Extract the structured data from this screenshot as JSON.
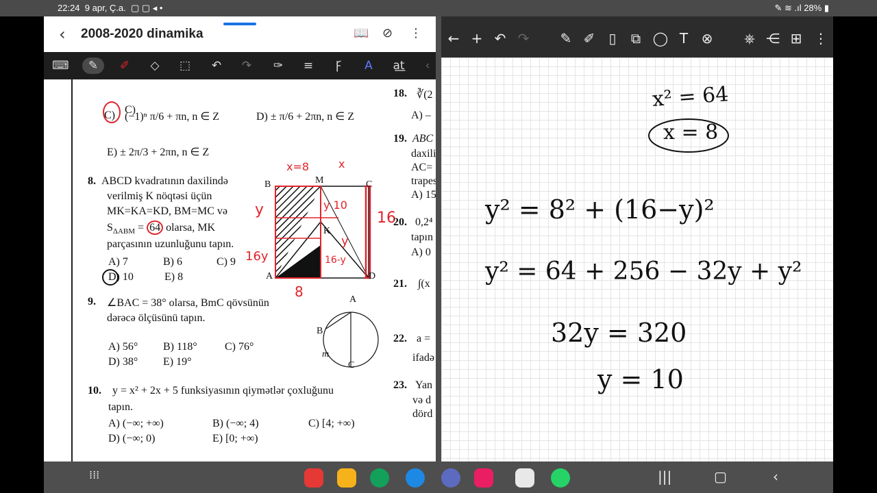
{
  "status": {
    "time": "22:24",
    "date": "9 apr, Ç.a.",
    "battery": "28%"
  },
  "doc": {
    "title": "2008-2020 dinamika",
    "q8": {
      "num": "8.",
      "l1": "ABCD kvadratının daxilində",
      "l2": "verilmiş K nöqtəsi üçün",
      "l3": "MK=KA=KD, BM=MC və",
      "l4a": "S",
      "l4sub": "ΔABM",
      "l4b": " = ",
      "l4val": "64",
      "l4c": " olarsa, MK",
      "l5": "parçasının uzunluğunu tapın.",
      "a": "A) 7",
      "b": "B) 6",
      "c": "C) 9",
      "d": "D) 10",
      "e": "E) 8"
    },
    "q7c": "(−1)ⁿ π/6 + πn, n ∈ Z",
    "q7d": "D) ± π/6 + 2πn, n ∈ Z",
    "q7e": "E) ± 2π/3 + 2πn, n ∈ Z",
    "q7c_label": "C)",
    "q9": {
      "num": "9.",
      "l1": "∠BAC = 38°  olarsa, BmC qövsünün",
      "l2": "dərəcə ölçüsünü tapın.",
      "a": "A) 56°",
      "b": "B) 118°",
      "c": "C) 76°",
      "d": "D) 38°",
      "e": "E) 19°"
    },
    "q10": {
      "num": "10.",
      "l1": "y = x² + 2x + 5  funksiyasının qiymətlər çoxluğunu",
      "l2": "tapın.",
      "a": "A) (−∞; +∞)",
      "b": "B) (−∞; 4)",
      "c": "C) [4; +∞)",
      "d": "D) (−∞; 0)",
      "e": "E) [0; +∞)"
    },
    "side": [
      "18.",
      "19.",
      "20.",
      "21.",
      "22.",
      "23."
    ],
    "side_text": [
      "∛(2",
      "A) –",
      "ABC",
      "daxili",
      "AC=",
      "trapes",
      "A) 15",
      "0,2⁴",
      "tapın",
      "A) 0",
      "∫(x",
      "a =",
      "ifadə",
      "Yan",
      "və d",
      "dörd"
    ],
    "fig": {
      "B": "B",
      "M": "M",
      "C": "C",
      "K": "K",
      "A": "A",
      "D": "D"
    },
    "ink": {
      "x8": "x=8",
      "x": "x",
      "y": "y",
      "y10": "y 10",
      "n16": "16",
      "ky": "y",
      "a16y": "16y",
      "b16y": "16-y",
      "n8": "8"
    }
  },
  "notebook": {
    "lines": [
      "x² = 64",
      "x = 8",
      "y² = 8² + (16−y)²",
      "y² = 64 + 256 − 32y + y²",
      "32y = 320",
      "y = 10"
    ]
  },
  "colors": {
    "accent": "#1a73e8",
    "ink_red": "#e0242b"
  }
}
